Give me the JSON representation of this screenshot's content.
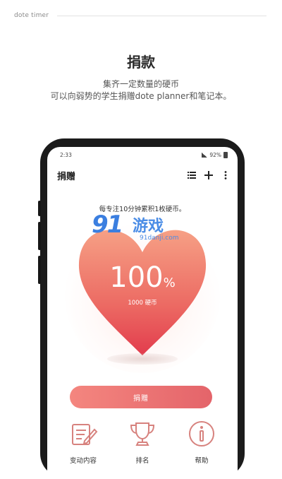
{
  "header": {
    "brand": "dote timer"
  },
  "hero": {
    "title": "捐款",
    "line1": "集齐一定数量的硬币",
    "line2": "可以向弱势的学生捐赠dote planner和笔记本。"
  },
  "phone": {
    "status": {
      "time": "2:33",
      "battery": "92%"
    },
    "appbar": {
      "title": "捐赠"
    },
    "intro": "每专注10分钟累积1枚硬币。",
    "progress": {
      "value": "100",
      "unit": "%",
      "fraction": 1.0
    },
    "coins_label": "1000 硬币",
    "donate_button": "捐赠",
    "bottom_menu": [
      {
        "label": "变动内容",
        "icon": "notepad-pencil-icon"
      },
      {
        "label": "排名",
        "icon": "trophy-icon"
      },
      {
        "label": "帮助",
        "icon": "info-icon"
      }
    ]
  },
  "watermark": {
    "brand_num": "91",
    "brand_text": "游戏",
    "url": "91danji.com"
  },
  "colors": {
    "accent": "#e8646a",
    "heart_top": "#f6a085",
    "heart_bottom": "#e43d4d"
  }
}
